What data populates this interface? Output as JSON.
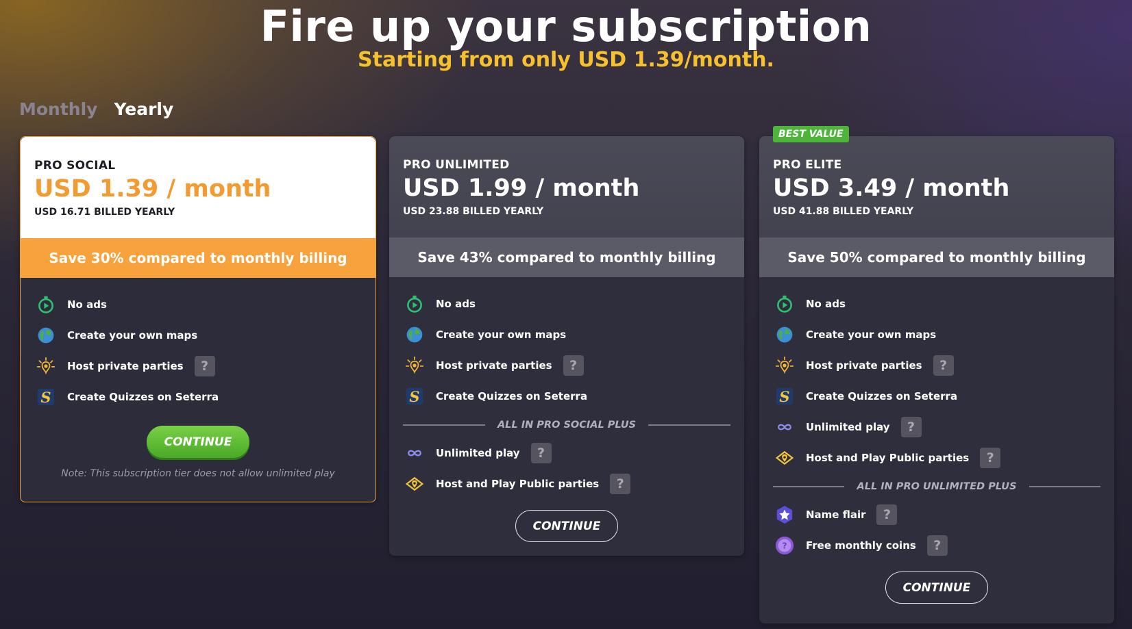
{
  "header": {
    "title": "Fire up your subscription",
    "subtitle": "Starting from only USD 1.39/month."
  },
  "billing_tabs": [
    {
      "label": "Monthly",
      "active": false
    },
    {
      "label": "Yearly",
      "active": true
    }
  ],
  "plans": [
    {
      "tier": "PRO SOCIAL",
      "price": "USD 1.39 / month",
      "billed": "USD 16.71 BILLED YEARLY",
      "save": "Save 30% compared to monthly billing",
      "features": [
        {
          "label": "No ads",
          "icon": "stopwatch-icon"
        },
        {
          "label": "Create your own maps",
          "icon": "globe-icon"
        },
        {
          "label": "Host private parties",
          "icon": "party-light-icon"
        },
        {
          "label": "Create Quizzes on Seterra",
          "icon": "seterra-icon"
        }
      ],
      "cta": "CONTINUE",
      "note": "Note: This subscription tier does not allow unlimited play"
    },
    {
      "tier": "PRO UNLIMITED",
      "price": "USD 1.99 / month",
      "billed": "USD 23.88 BILLED YEARLY",
      "save": "Save 43% compared to monthly billing",
      "features": [
        {
          "label": "No ads",
          "icon": "stopwatch-icon"
        },
        {
          "label": "Create your own maps",
          "icon": "globe-icon"
        },
        {
          "label": "Host private parties",
          "icon": "party-light-icon"
        },
        {
          "label": "Create Quizzes on Seterra",
          "icon": "seterra-icon"
        }
      ],
      "divider": "ALL IN PRO SOCIAL PLUS",
      "extra": [
        {
          "label": "Unlimited play",
          "icon": "infinity-icon"
        },
        {
          "label": "Host and Play Public parties",
          "icon": "public-party-icon"
        }
      ],
      "cta": "CONTINUE"
    },
    {
      "badge": "BEST VALUE",
      "tier": "PRO ELITE",
      "price": "USD 3.49 / month",
      "billed": "USD 41.88 BILLED YEARLY",
      "save": "Save 50% compared to monthly billing",
      "features": [
        {
          "label": "No ads",
          "icon": "stopwatch-icon"
        },
        {
          "label": "Create your own maps",
          "icon": "globe-icon"
        },
        {
          "label": "Host private parties",
          "icon": "party-light-icon"
        },
        {
          "label": "Create Quizzes on Seterra",
          "icon": "seterra-icon"
        },
        {
          "label": "Unlimited play",
          "icon": "infinity-icon"
        },
        {
          "label": "Host and Play Public parties",
          "icon": "public-party-icon"
        }
      ],
      "divider": "ALL IN PRO UNLIMITED PLUS",
      "extra": [
        {
          "label": "Name flair",
          "icon": "star-badge-icon"
        },
        {
          "label": "Free monthly coins",
          "icon": "coin-icon"
        }
      ],
      "cta": "CONTINUE"
    }
  ],
  "help_symbol": "?",
  "colors": {
    "accent_orange": "#f7a23c",
    "title_yellow": "#f6c02e",
    "best_green": "#4eb53a"
  }
}
